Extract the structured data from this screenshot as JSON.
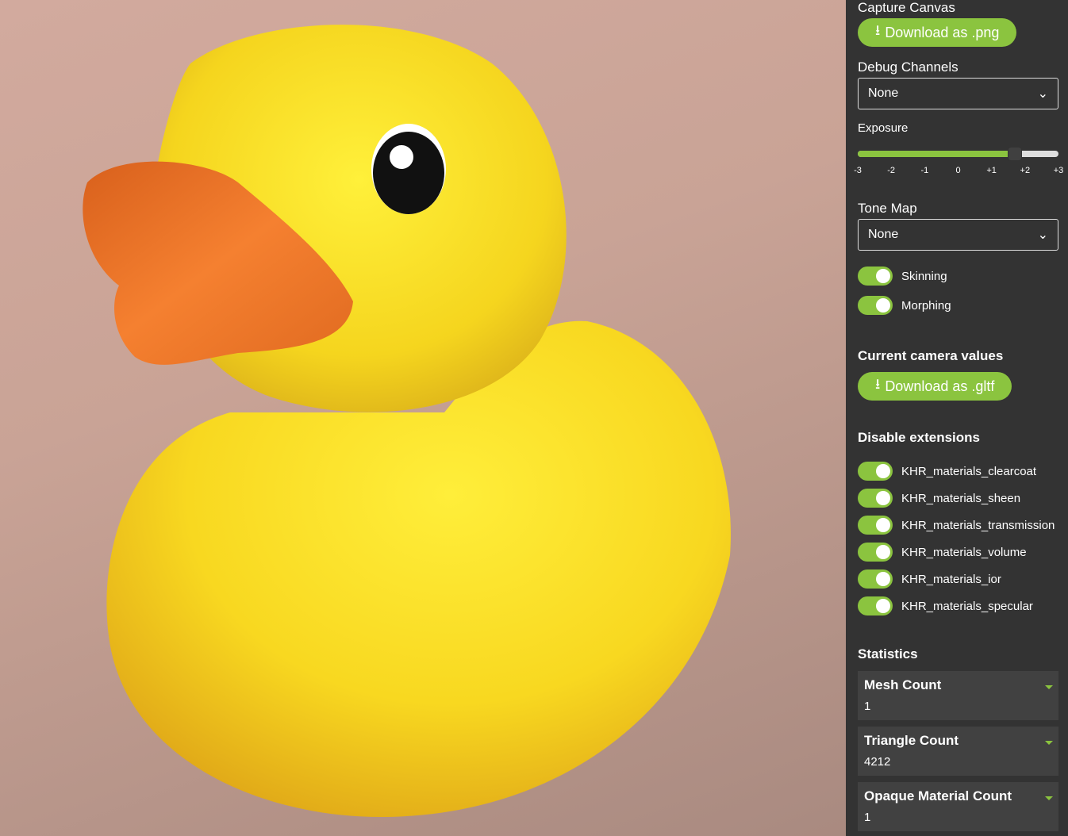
{
  "capture": {
    "title": "Capture Canvas",
    "button": "Download as .png",
    "icon": "download-icon"
  },
  "debug": {
    "title": "Debug Channels",
    "value": "None"
  },
  "exposure": {
    "title": "Exposure",
    "value": 1.7,
    "min": -3,
    "max": 3,
    "ticks": [
      "-3",
      "-2",
      "-1",
      "0",
      "+1",
      "+2",
      "+3"
    ]
  },
  "tonemap": {
    "title": "Tone Map",
    "value": "None"
  },
  "toggles": [
    {
      "label": "Skinning",
      "on": true
    },
    {
      "label": "Morphing",
      "on": true
    }
  ],
  "camera": {
    "title": "Current camera values",
    "button": "Download as .gltf"
  },
  "extensions": {
    "title": "Disable extensions",
    "items": [
      {
        "label": "KHR_materials_clearcoat",
        "on": true
      },
      {
        "label": "KHR_materials_sheen",
        "on": true
      },
      {
        "label": "KHR_materials_transmission",
        "on": true
      },
      {
        "label": "KHR_materials_volume",
        "on": true
      },
      {
        "label": "KHR_materials_ior",
        "on": true
      },
      {
        "label": "KHR_materials_specular",
        "on": true
      }
    ]
  },
  "statistics": {
    "title": "Statistics",
    "items": [
      {
        "label": "Mesh Count",
        "value": "1"
      },
      {
        "label": "Triangle Count",
        "value": "4212"
      },
      {
        "label": "Opaque Material Count",
        "value": "1"
      }
    ]
  },
  "colors": {
    "accent": "#8bc43f",
    "panel": "#333333"
  }
}
